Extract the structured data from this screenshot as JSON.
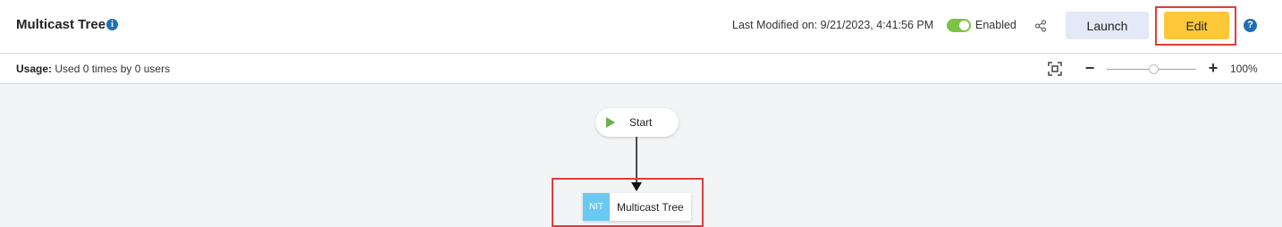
{
  "header": {
    "title": "Multicast Tree",
    "info_icon": "i",
    "last_modified": "Last Modified on: 9/21/2023, 4:41:56 PM",
    "toggle_label": "Enabled",
    "toggle_state": "on",
    "launch_label": "Launch",
    "edit_label": "Edit",
    "help_icon": "?"
  },
  "usage": {
    "label": "Usage:",
    "text": "Used 0 times by 0 users"
  },
  "zoom": {
    "minus": "−",
    "plus": "+",
    "level": "100%"
  },
  "canvas": {
    "start_label": "Start",
    "task_tag": "NIT",
    "task_label": "Multicast Tree"
  },
  "colors": {
    "edit_button": "#fcc838",
    "launch_button": "#e3e9f6",
    "toggle_on": "#7dc242",
    "highlight_frame": "#e03c3c",
    "task_tag": "#68c9f2",
    "start_play": "#6ab04c"
  }
}
